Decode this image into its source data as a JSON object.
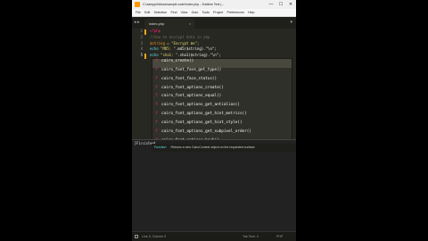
{
  "window": {
    "title": "C:\\xampp\\htdocs\\sample code\\index.php - Sublime Text (...",
    "controls": {
      "minimize": "—",
      "maximize": "☐",
      "close": "✕"
    }
  },
  "menu": [
    "File",
    "Edit",
    "Selection",
    "Find",
    "View",
    "Goto",
    "Tools",
    "Project",
    "Preferences",
    "Help"
  ],
  "tabs": [
    {
      "label": "index.php",
      "close": "×"
    }
  ],
  "nav_arrows": "◂ ▸",
  "dropdown_arrow": "▾",
  "gutter": [
    "1",
    "2",
    "3",
    "4",
    "5"
  ],
  "code": {
    "line1": "<?php",
    "line2": "//how to encrypt data in php",
    "line3_var": "$string",
    "line3_rest": " = \"Encrypt me\";",
    "line4_kw": "echo",
    "line4_str": " \"MD5: \"",
    "line4_rest": ".md5($string).\"\\n\";",
    "line5_kw": "echo",
    "line5_str": " \"sha1: \"",
    "line5_rest": ".sha1($string).\"\\n\";"
  },
  "autocomplete": {
    "kind": "f",
    "items": [
      "cairo_create()",
      "cairo_font_face_get_type()",
      "cairo_font_face_status()",
      "cairo_font_options_create()",
      "cairo_font_options_equal()",
      "cairo_font_options_get_antialias()",
      "cairo_font_options_get_hint_metrics()",
      "cairo_font_options_get_hint_style()",
      "cairo_font_options_get_subpixel_order()",
      "cairo_font_options_hash()"
    ],
    "selected_index": 0,
    "footer_kind": "Function",
    "footer_desc": "Returns a new CairoContext object on the requested surface."
  },
  "console": "[Finished",
  "status": {
    "position": "Line 5, Column 5",
    "tab_size": "Tab Size: 4",
    "syntax": "PHP"
  }
}
